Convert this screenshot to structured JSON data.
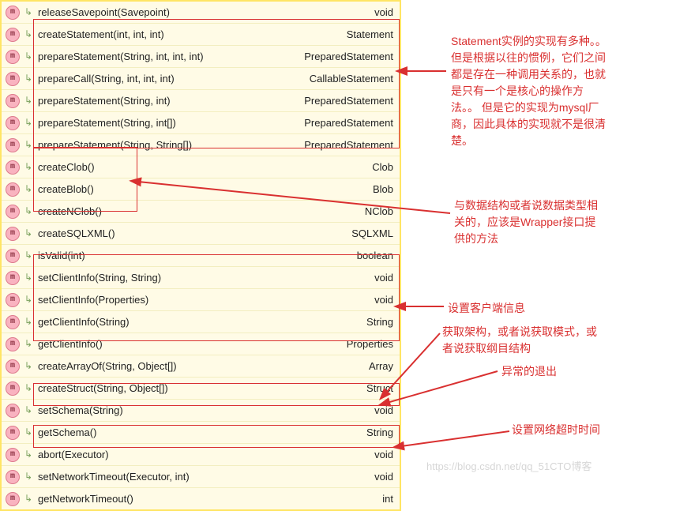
{
  "iconLetter": "m",
  "rows": [
    {
      "sub": "↳",
      "name": "releaseSavepoint(Savepoint)",
      "ret": "void"
    },
    {
      "sub": "↳",
      "name": "createStatement(int, int, int)",
      "ret": "Statement"
    },
    {
      "sub": "↳",
      "name": "prepareStatement(String, int, int, int)",
      "ret": "PreparedStatement"
    },
    {
      "sub": "↳",
      "name": "prepareCall(String, int, int, int)",
      "ret": "CallableStatement"
    },
    {
      "sub": "↳",
      "name": "prepareStatement(String, int)",
      "ret": "PreparedStatement"
    },
    {
      "sub": "↳",
      "name": "prepareStatement(String, int[])",
      "ret": "PreparedStatement"
    },
    {
      "sub": "↳",
      "name": "prepareStatement(String, String[])",
      "ret": "PreparedStatement"
    },
    {
      "sub": "↳",
      "name": "createClob()",
      "ret": "Clob"
    },
    {
      "sub": "↳",
      "name": "createBlob()",
      "ret": "Blob"
    },
    {
      "sub": "↳",
      "name": "createNClob()",
      "ret": "NClob"
    },
    {
      "sub": "↳",
      "name": "createSQLXML()",
      "ret": "SQLXML"
    },
    {
      "sub": "↳",
      "name": "isValid(int)",
      "ret": "boolean"
    },
    {
      "sub": "↳",
      "name": "setClientInfo(String, String)",
      "ret": "void"
    },
    {
      "sub": "↳",
      "name": "setClientInfo(Properties)",
      "ret": "void"
    },
    {
      "sub": "↳",
      "name": "getClientInfo(String)",
      "ret": "String"
    },
    {
      "sub": "↳",
      "name": "getClientInfo()",
      "ret": "Properties"
    },
    {
      "sub": "↳",
      "name": "createArrayOf(String, Object[])",
      "ret": "Array"
    },
    {
      "sub": "↳",
      "name": "createStruct(String, Object[])",
      "ret": "Struct"
    },
    {
      "sub": "↳",
      "name": "setSchema(String)",
      "ret": "void"
    },
    {
      "sub": "↳",
      "name": "getSchema()",
      "ret": "String"
    },
    {
      "sub": "↳",
      "name": "abort(Executor)",
      "ret": "void"
    },
    {
      "sub": "↳",
      "name": "setNetworkTimeout(Executor, int)",
      "ret": "void"
    },
    {
      "sub": "↳",
      "name": "getNetworkTimeout()",
      "ret": "int"
    }
  ],
  "notes": {
    "n1": "Statement实例的实现有多种。。\n但是根据以往的惯例，它们之间\n都是存在一种调用关系的，也就\n是只有一个是核心的操作方\n法。。 但是它的实现为mysql厂\n商，因此具体的实现就不是很清\n楚。",
    "n2": "与数据结构或者说数据类型相\n关的，应该是Wrapper接口提\n供的方法",
    "n3": "设置客户端信息",
    "n4": "获取架构，或者说获取模式，或\n者说获取纲目结构",
    "n5": "异常的退出",
    "n6": "设置网络超时时间"
  },
  "watermark": "https://blog.csdn.net/qq_51CTO博客"
}
